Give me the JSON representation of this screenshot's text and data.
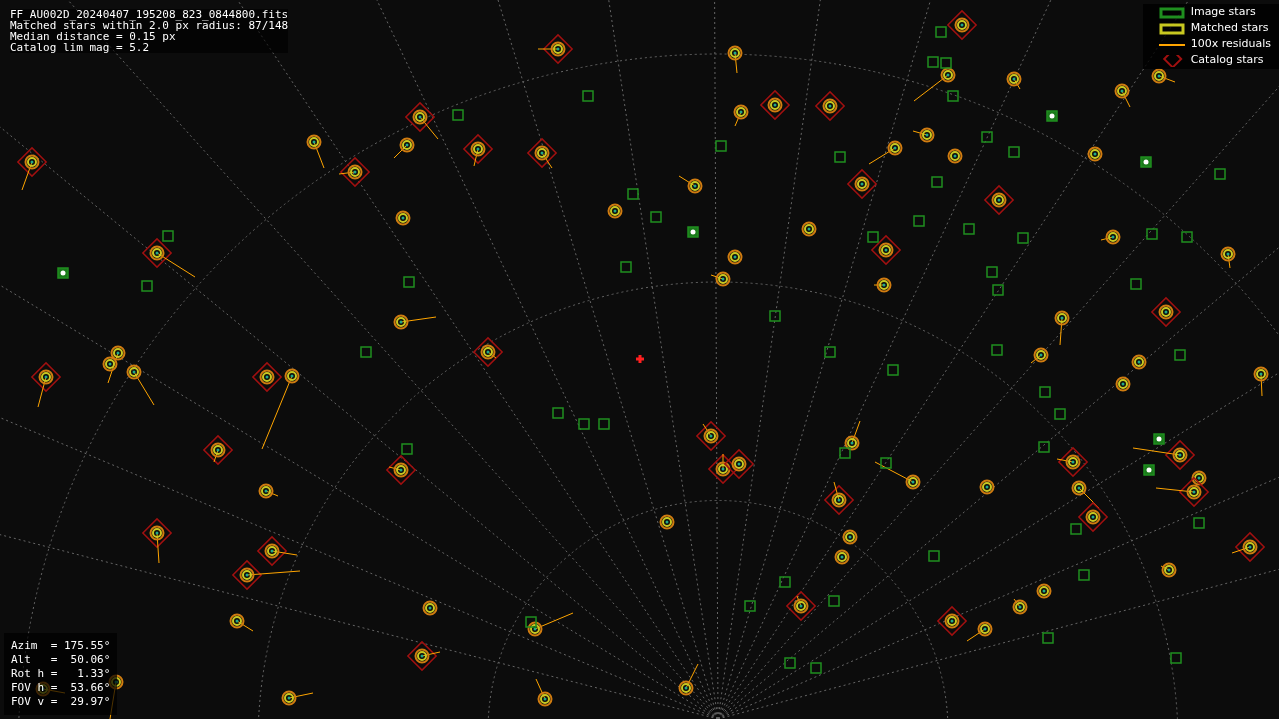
{
  "header": {
    "lines": [
      "FF_AU002D_20240407_195208_823_0844800.fits",
      "Matched stars within 2.0 px radius: 87/148",
      "Median distance = 0.15 px",
      "Catalog lim mag = 5.2"
    ]
  },
  "legend": [
    {
      "kind": "image",
      "label": "Image stars",
      "color": "#1f8f1f"
    },
    {
      "kind": "matched",
      "label": "Matched stars",
      "color": "#c8c820"
    },
    {
      "kind": "residual",
      "label": "100x residuals",
      "color": "#ffa500"
    },
    {
      "kind": "catalog",
      "label": "Catalog stars",
      "color": "#a01010"
    }
  ],
  "pointing": {
    "lines": [
      "Azim  = 175.55°",
      "Alt   =  50.06°",
      "Rot h =   1.33°",
      "FOV h =  53.66°",
      "FOV v =  29.97°"
    ]
  }
}
